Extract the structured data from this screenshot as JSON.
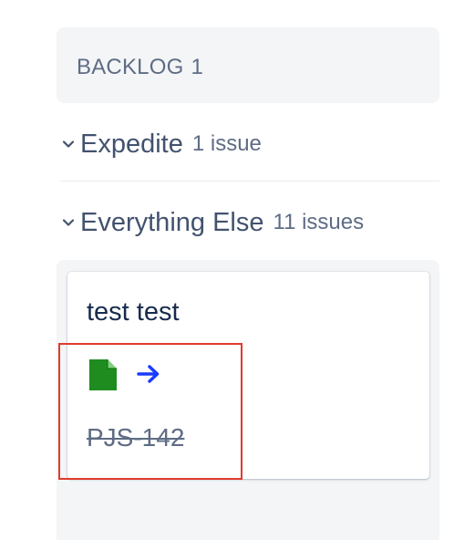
{
  "column": {
    "title": "BACKLOG",
    "count": "1"
  },
  "swimlanes": [
    {
      "title": "Expedite",
      "count": "1 issue",
      "expanded": true
    },
    {
      "title": "Everything Else",
      "count": "11 issues",
      "expanded": true
    }
  ],
  "card": {
    "summary": "test test",
    "type_icon": "story-document-icon",
    "priority_icon": "arrow-right-icon",
    "key": "PJS-142",
    "key_resolved": true
  },
  "colors": {
    "type_icon": "#1f8c1f",
    "priority_icon": "#1a3cff",
    "highlight": "#e03a2c"
  }
}
